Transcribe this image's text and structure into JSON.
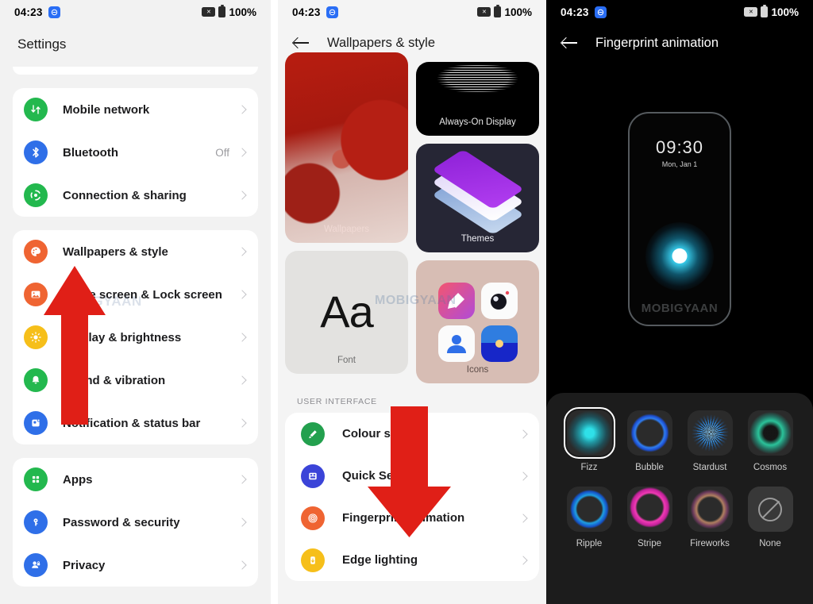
{
  "status_bar": {
    "time": "04:23",
    "battery": "100%",
    "badge_icon": "dnd-badge-icon",
    "camera_off_icon": "camera-off-icon",
    "battery_icon": "battery-icon"
  },
  "panel_settings": {
    "title": "Settings",
    "groups": [
      {
        "items": [
          {
            "label": "Mobile network",
            "value": "",
            "icon": "mobile-network-icon",
            "color": "#23b84e"
          },
          {
            "label": "Bluetooth",
            "value": "Off",
            "icon": "bluetooth-icon",
            "color": "#2f6fe8"
          },
          {
            "label": "Connection & sharing",
            "value": "",
            "icon": "connection-sharing-icon",
            "color": "#23b84e"
          }
        ]
      },
      {
        "items": [
          {
            "label": "Wallpapers & style",
            "value": "",
            "icon": "palette-icon",
            "color": "#ef6432"
          },
          {
            "label": "Home screen & Lock screen",
            "value": "",
            "icon": "image-icon",
            "color": "#ef6432"
          },
          {
            "label": "Display & brightness",
            "value": "",
            "icon": "brightness-icon",
            "color": "#f6bf1a"
          },
          {
            "label": "Sound & vibration",
            "value": "",
            "icon": "bell-icon",
            "color": "#23b84e"
          },
          {
            "label": "Notification & status bar",
            "value": "",
            "icon": "notification-icon",
            "color": "#2f6fe8"
          }
        ]
      },
      {
        "items": [
          {
            "label": "Apps",
            "value": "",
            "icon": "apps-grid-icon",
            "color": "#23b84e"
          },
          {
            "label": "Password & security",
            "value": "",
            "icon": "key-icon",
            "color": "#2f6fe8"
          },
          {
            "label": "Privacy",
            "value": "",
            "icon": "privacy-icon",
            "color": "#2f6fe8"
          }
        ]
      }
    ]
  },
  "panel_wallpapers": {
    "nav_title": "Wallpapers & style",
    "back_icon": "back-arrow-icon",
    "tiles": [
      {
        "caption": "Wallpapers",
        "name": "wallpapers-tile"
      },
      {
        "caption": "Always-On Display",
        "name": "always-on-display-tile"
      },
      {
        "caption": "Themes",
        "name": "themes-tile"
      },
      {
        "caption": "Font",
        "name": "font-tile",
        "sample": "Aa"
      },
      {
        "caption": "Icons",
        "name": "icons-tile"
      }
    ],
    "section_label": "USER INTERFACE",
    "items": [
      {
        "label": "Colour scheme",
        "icon": "colour-scheme-icon",
        "color": "#23a04e"
      },
      {
        "label": "Quick Settings",
        "icon": "quick-settings-icon",
        "color": "#3b44d8"
      },
      {
        "label": "Fingerprint animation",
        "icon": "fingerprint-animation-icon",
        "color": "#ef6432"
      },
      {
        "label": "Edge lighting",
        "icon": "edge-lighting-icon",
        "color": "#f6bf1a"
      }
    ]
  },
  "panel_fingerprint": {
    "nav_title": "Fingerprint animation",
    "back_icon": "back-arrow-icon",
    "preview": {
      "time": "09:30",
      "date": "Mon, Jan 1"
    },
    "options": [
      {
        "label": "Fizz",
        "selected": true
      },
      {
        "label": "Bubble",
        "selected": false
      },
      {
        "label": "Stardust",
        "selected": false
      },
      {
        "label": "Cosmos",
        "selected": false
      },
      {
        "label": "Ripple",
        "selected": false
      },
      {
        "label": "Stripe",
        "selected": false
      },
      {
        "label": "Fireworks",
        "selected": false
      },
      {
        "label": "None",
        "selected": false
      }
    ]
  },
  "annotations": {
    "arrow_up": "red-up-arrow",
    "arrow_down": "red-down-arrow",
    "arrow_color": "#e01f17",
    "watermark": "MOBIGYAAN"
  }
}
